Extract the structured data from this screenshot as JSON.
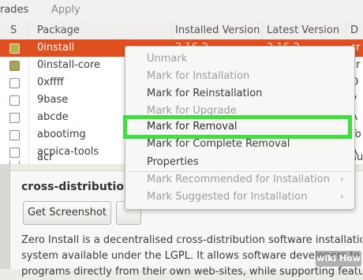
{
  "toolbar": {
    "upgrades_label": "rades",
    "apply_label": "Apply"
  },
  "table": {
    "columns": {
      "status": "S",
      "package": "Package",
      "installed": "Installed Version",
      "latest": "Latest Version",
      "description": "D"
    },
    "rows": [
      {
        "package": "0install",
        "installed": "2.16-2",
        "latest": "2.16-2",
        "edge": "cr",
        "installed_state": true,
        "selected": true
      },
      {
        "package": "0install-core",
        "installed": "",
        "latest": "",
        "edge": "cr",
        "installed_state": true,
        "selected": false
      },
      {
        "package": "0xffff",
        "installed": "",
        "latest": "",
        "edge": "O",
        "installed_state": false,
        "selected": false
      },
      {
        "package": "9base",
        "installed": "",
        "latest": "",
        "edge": "P",
        "installed_state": false,
        "selected": false
      },
      {
        "package": "abcde",
        "installed": "",
        "latest": "",
        "edge": "A",
        "installed_state": false,
        "selected": false
      },
      {
        "package": "abootimg",
        "installed": "",
        "latest": "",
        "edge": "To",
        "installed_state": false,
        "selected": false
      },
      {
        "package": "acpica-tools",
        "installed": "",
        "latest": "",
        "edge": "A",
        "installed_state": false,
        "selected": false
      },
      {
        "package": "acr",
        "installed": "",
        "latest": "",
        "edge": "au",
        "installed_state": false,
        "selected": false
      }
    ]
  },
  "details": {
    "title": "cross-distribution p",
    "get_screenshot_label": "Get Screenshot",
    "description_lines": [
      "Zero Install is a decentralised cross-distribution software installation",
      "system available under the LGPL. It allows software developers to publish",
      "programs directly from their own web-sites, while supporting features"
    ]
  },
  "context_menu": {
    "items": [
      {
        "label": "Unmark",
        "enabled": false
      },
      {
        "label": "Mark for Installation",
        "enabled": false
      },
      {
        "label": "Mark for Reinstallation",
        "enabled": true
      },
      {
        "label": "Mark for Upgrade",
        "enabled": false
      },
      {
        "label": "Mark for Removal",
        "enabled": true,
        "highlighted": true
      },
      {
        "label": "Mark for Complete Removal",
        "enabled": true
      },
      {
        "label": "Properties",
        "enabled": true
      },
      {
        "label": "Mark Recommended for Installation",
        "enabled": false,
        "submenu": true
      },
      {
        "label": "Mark Suggested for Installation",
        "enabled": false,
        "submenu": true
      }
    ]
  },
  "watermark": {
    "text": "wiki How"
  },
  "colors": {
    "selection": "#e04f1f",
    "highlight_box": "#3ee03e",
    "installed_check": "#a8a55a"
  }
}
